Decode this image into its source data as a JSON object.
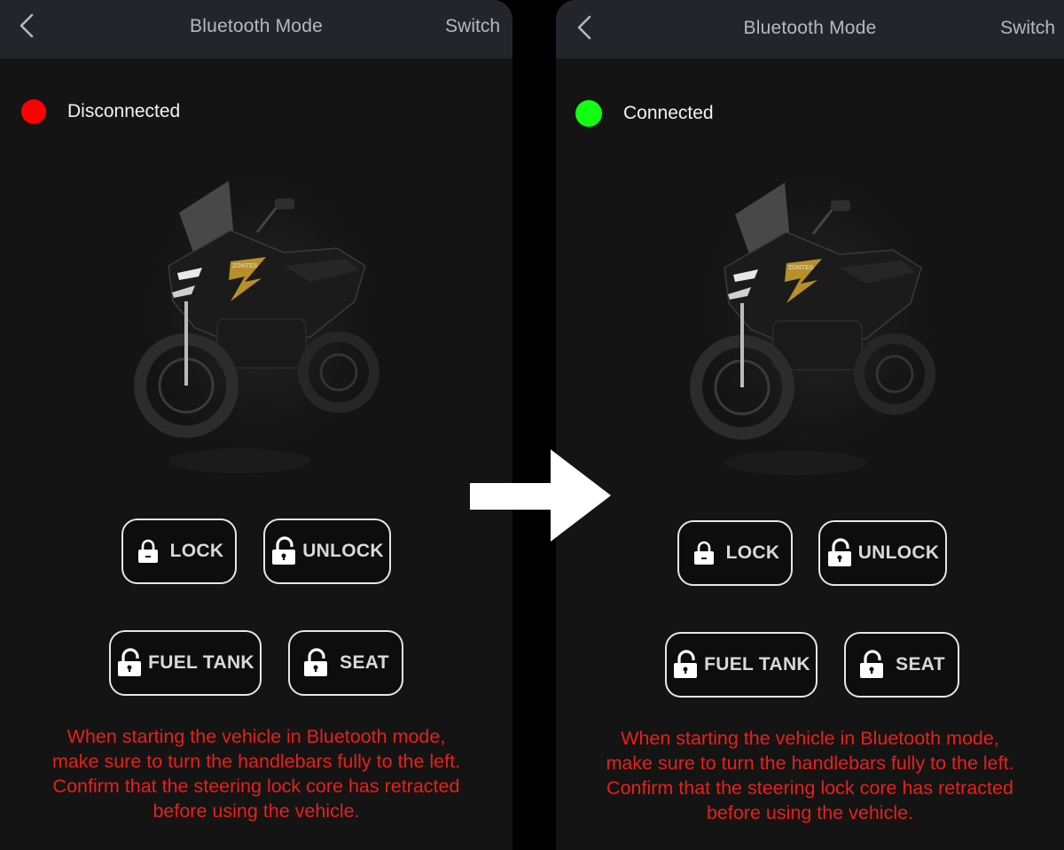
{
  "colors": {
    "disconnected": "#ff0000",
    "connected": "#12ff12",
    "notice": "#e8201a"
  },
  "panels": [
    {
      "header": {
        "title": "Bluetooth Mode",
        "switch_label": "Switch",
        "back_icon": "chevron-left-icon"
      },
      "status": {
        "text": "Disconnected",
        "state": "disconnected"
      },
      "buttons": {
        "lock": "LOCK",
        "unlock": "UNLOCK",
        "fuel_tank": "FUEL TANK",
        "seat": "SEAT"
      },
      "notice": [
        "When starting the vehicle in Bluetooth mode,",
        "make sure to turn the handlebars fully to the left.",
        "Confirm that the steering lock core has retracted",
        "before using the vehicle."
      ]
    },
    {
      "header": {
        "title": "Bluetooth Mode",
        "switch_label": "Switch",
        "back_icon": "chevron-left-icon"
      },
      "status": {
        "text": "Connected",
        "state": "connected"
      },
      "buttons": {
        "lock": "LOCK",
        "unlock": "UNLOCK",
        "fuel_tank": "FUEL TANK",
        "seat": "SEAT"
      },
      "notice": [
        "When starting the vehicle in Bluetooth mode,",
        "make sure to turn the handlebars fully to the left.",
        "Confirm that the steering lock core has retracted",
        "before using the vehicle."
      ]
    }
  ],
  "transition_icon": "right-arrow-icon",
  "vehicle_logo": "ZONTES"
}
